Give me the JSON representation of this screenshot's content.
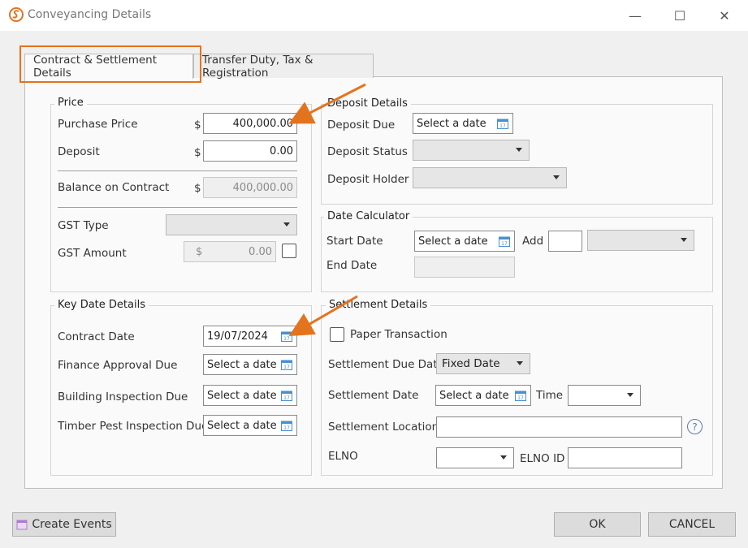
{
  "window": {
    "title": "Conveyancing Details",
    "minimize": "—",
    "maximize": "☐",
    "close": "✕"
  },
  "tabs": [
    {
      "label": "Contract & Settlement Details",
      "active": true
    },
    {
      "label": "Transfer Duty, Tax & Registration",
      "active": false
    }
  ],
  "price": {
    "title": "Price",
    "purchase_price_label": "Purchase Price",
    "purchase_price_value": "400,000.00",
    "deposit_label": "Deposit",
    "deposit_value": "0.00",
    "balance_label": "Balance on Contract",
    "balance_value": "400,000.00",
    "gst_type_label": "GST Type",
    "gst_type_value": "",
    "gst_amount_label": "GST Amount",
    "gst_amount_value": "0.00",
    "currency": "$"
  },
  "deposit_details": {
    "title": "Deposit Details",
    "due_label": "Deposit Due",
    "due_value": "Select a date",
    "status_label": "Deposit Status",
    "status_value": "",
    "holder_label": "Deposit Holder",
    "holder_value": ""
  },
  "date_calculator": {
    "title": "Date Calculator",
    "start_label": "Start Date",
    "start_value": "Select a date",
    "add_label": "Add",
    "add_value": "",
    "unit_value": "",
    "end_label": "End Date",
    "end_value": ""
  },
  "key_dates": {
    "title": "Key Date Details",
    "contract_label": "Contract Date",
    "contract_value": "19/07/2024",
    "finance_label": "Finance Approval Due",
    "finance_value": "Select a date",
    "building_label": "Building Inspection Due",
    "building_value": "Select a date",
    "pest_label": "Timber Pest Inspection Due",
    "pest_value": "Select a date"
  },
  "settlement": {
    "title": "Settlement Details",
    "paper_label": "Paper Transaction",
    "due_date_label": "Settlement Due Date",
    "due_date_value": "Fixed Date",
    "date_label": "Settlement Date",
    "date_value": "Select a date",
    "time_label": "Time",
    "time_value": "",
    "location_label": "Settlement Location",
    "location_value": "",
    "help_icon": "?",
    "elno_label": "ELNO",
    "elno_value": "",
    "elno_id_label": "ELNO ID",
    "elno_id_value": ""
  },
  "footer": {
    "create_events_label": "Create Events",
    "ok_label": "OK",
    "cancel_label": "CANCEL"
  },
  "colors": {
    "accent_orange": "#e4731e",
    "help_blue": "#5b79b8"
  },
  "icons": [
    "app-logo-icon",
    "calendar-icon",
    "help-icon",
    "chevron-down-icon",
    "arrow-annotation"
  ]
}
